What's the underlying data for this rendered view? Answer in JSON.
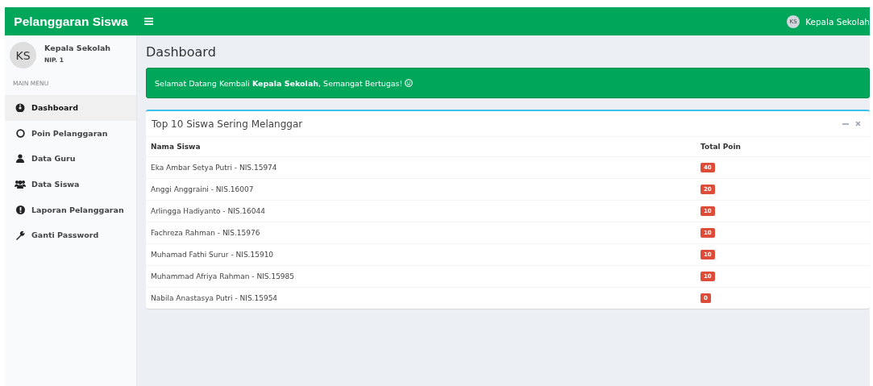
{
  "header": {
    "brand": "Pelanggaran Siswa",
    "user_initials": "KS",
    "user_name": "Kepala Sekolah"
  },
  "sidebar": {
    "user": {
      "initials": "KS",
      "name": "Kepala Sekolah",
      "nip": "NIP. 1"
    },
    "menu_heading": "MAIN MENU",
    "items": [
      {
        "label": "Dashboard",
        "selected": true
      },
      {
        "label": "Poin Pelanggaran",
        "selected": false
      },
      {
        "label": "Data Guru",
        "selected": false
      },
      {
        "label": "Data Siswa",
        "selected": false
      },
      {
        "label": "Laporan Pelanggaran",
        "selected": false
      },
      {
        "label": "Ganti Password",
        "selected": false
      }
    ]
  },
  "page_title": "Dashboard",
  "alert": {
    "message": "Selamat Datang Kembali **Kepala Sekolah**, Semangat Bertugas!"
  },
  "box": {
    "title": "Top 10 Siswa Sering Melanggar",
    "columns": [
      "Nama Siswa",
      "Total Poin"
    ],
    "rows": [
      {
        "name": "Eka Ambar Setya Putri - NIS.15974",
        "points": "40"
      },
      {
        "name": "Anggi Anggraini - NIS.16007",
        "points": "20"
      },
      {
        "name": "Arlingga Hadiyanto - NIS.16044",
        "points": "10"
      },
      {
        "name": "Fachreza Rahman - NIS.15976",
        "points": "10"
      },
      {
        "name": "Muhamad Fathi Surur - NIS.15910",
        "points": "10"
      },
      {
        "name": "Muhammad Afriya Rahman - NIS.15985",
        "points": "10"
      },
      {
        "name": "Nabila Anastasya Putri - NIS.15954",
        "points": "0"
      }
    ]
  }
}
